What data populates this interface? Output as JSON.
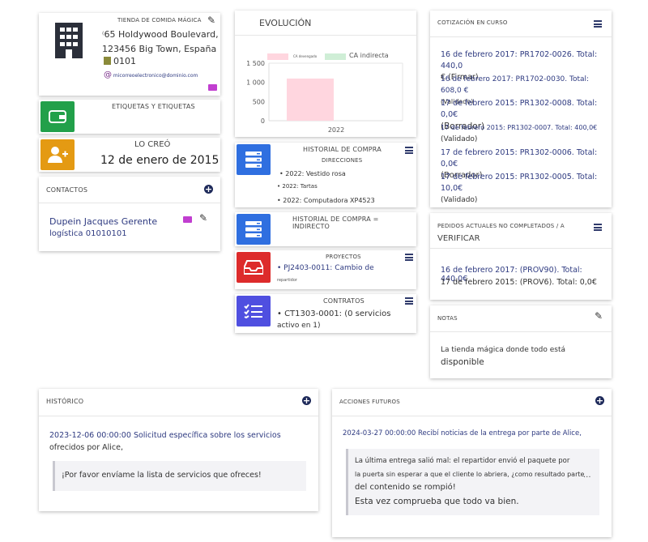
{
  "company": {
    "title": "TIENDA DE COMIDA MÁGICA",
    "address1": "65 Holdywood Boulevard,",
    "address2": "123456 Big Town, España",
    "code": "0101",
    "email": "micorreoelectronico@dominio.com"
  },
  "tags": {
    "title": "ETIQUETAS Y ETIQUETAS"
  },
  "created": {
    "label": "LO CREÓ",
    "date": "12 de enero de 2015"
  },
  "contacts": {
    "title": "CONTACTOS",
    "name": "Dupein Jacques Gerente",
    "role": "logística 01010101"
  },
  "evolution": {
    "title": "EVOLUCIÓN",
    "legend_a": "CA devengado",
    "legend_b": "CA indirecta",
    "yticks": [
      "1 500",
      "1 000",
      "500",
      "0"
    ],
    "xlabel": "2022"
  },
  "chart_data": {
    "type": "bar",
    "title": "EVOLUCIÓN",
    "categories": [
      "2022"
    ],
    "series": [
      {
        "name": "CA devengado",
        "values": [
          1100
        ]
      },
      {
        "name": "CA indirecta",
        "values": [
          0
        ]
      }
    ],
    "ylim": [
      0,
      1500
    ],
    "colors": [
      "#ffd6df",
      "#cfeed6"
    ]
  },
  "purchase": {
    "title": "HISTORIAL DE COMPRA",
    "subtitle": "DIRECCIONES",
    "items": [
      "2022: Vestido rosa",
      "2022: Tartas",
      "2022: Computadora XP4523"
    ]
  },
  "purchase_indirect": {
    "title": "HISTORIAL DE COMPRA = INDIRECTO"
  },
  "projects": {
    "title": "PROYECTOS",
    "item": "PJ2403-0011: Cambio de",
    "item_sub": "repartidor"
  },
  "contracts": {
    "title": "CONTRATOS",
    "item1": "CT1303-0001: (0 servicios",
    "item2": "activo en 1)"
  },
  "quotes": {
    "title": "COTIZACIÓN EN CURSO",
    "items": [
      {
        "text": "16 de febrero 2017: PR1702-0026. Total: 440,0",
        "extra": "€ (Firmar)"
      },
      {
        "text": "16 de febrero 2017: PR1702-0030. Total: 608,0 €",
        "extra": "(Validado)"
      },
      {
        "text": "17 de febrero 2015: PR1302-0008. Total: 0,0€",
        "extra": "(Borrador)"
      },
      {
        "text": "17 de febrero 2015: PR1302-0007. Total: 400,0€",
        "extra": "(Validado)"
      },
      {
        "text": "17 de febrero 2015: PR1302-0006. Total: 0,0€",
        "extra": "(Borrador)"
      },
      {
        "text": "17 de febrero 2015: PR1302-0005. Total: 10,0€",
        "extra": "(Validado)"
      }
    ]
  },
  "orders": {
    "title": "PEDIDOS ACTUALES NO COMPLETADOS / A",
    "title2": "VERIFICAR",
    "items": [
      "16 de febrero 2017: (PROV90). Total: 440,0€",
      "17 de febrero 2015: (PROV6). Total: 0,0€"
    ]
  },
  "notes": {
    "title": "NOTAS",
    "line1": "La tienda mágica donde todo está",
    "line2": "disponible"
  },
  "history": {
    "title": "HISTÓRICO",
    "date": "2023-12-06 00:00:00",
    "text1": "Solicitud específica sobre los servicios",
    "text2": "ofrecidos por Alice,",
    "quote": "¡Por favor envíame la lista de servicios que ofreces!"
  },
  "future": {
    "title": "ACCIONES FUTUROS",
    "date": "2024-03-27 00:00:00",
    "text": "Recibí noticias de la entrega por parte de Alice,",
    "q1": "La última entrega salió mal: el repartidor envió el paquete por",
    "q2": "la puerta sin esperar a que el cliente lo abriera, ¿como resultado parte",
    "q3": "del contenido se rompió!",
    "q4": "Esta vez comprueba que todo va bien.",
    "ellipsis": "..."
  }
}
